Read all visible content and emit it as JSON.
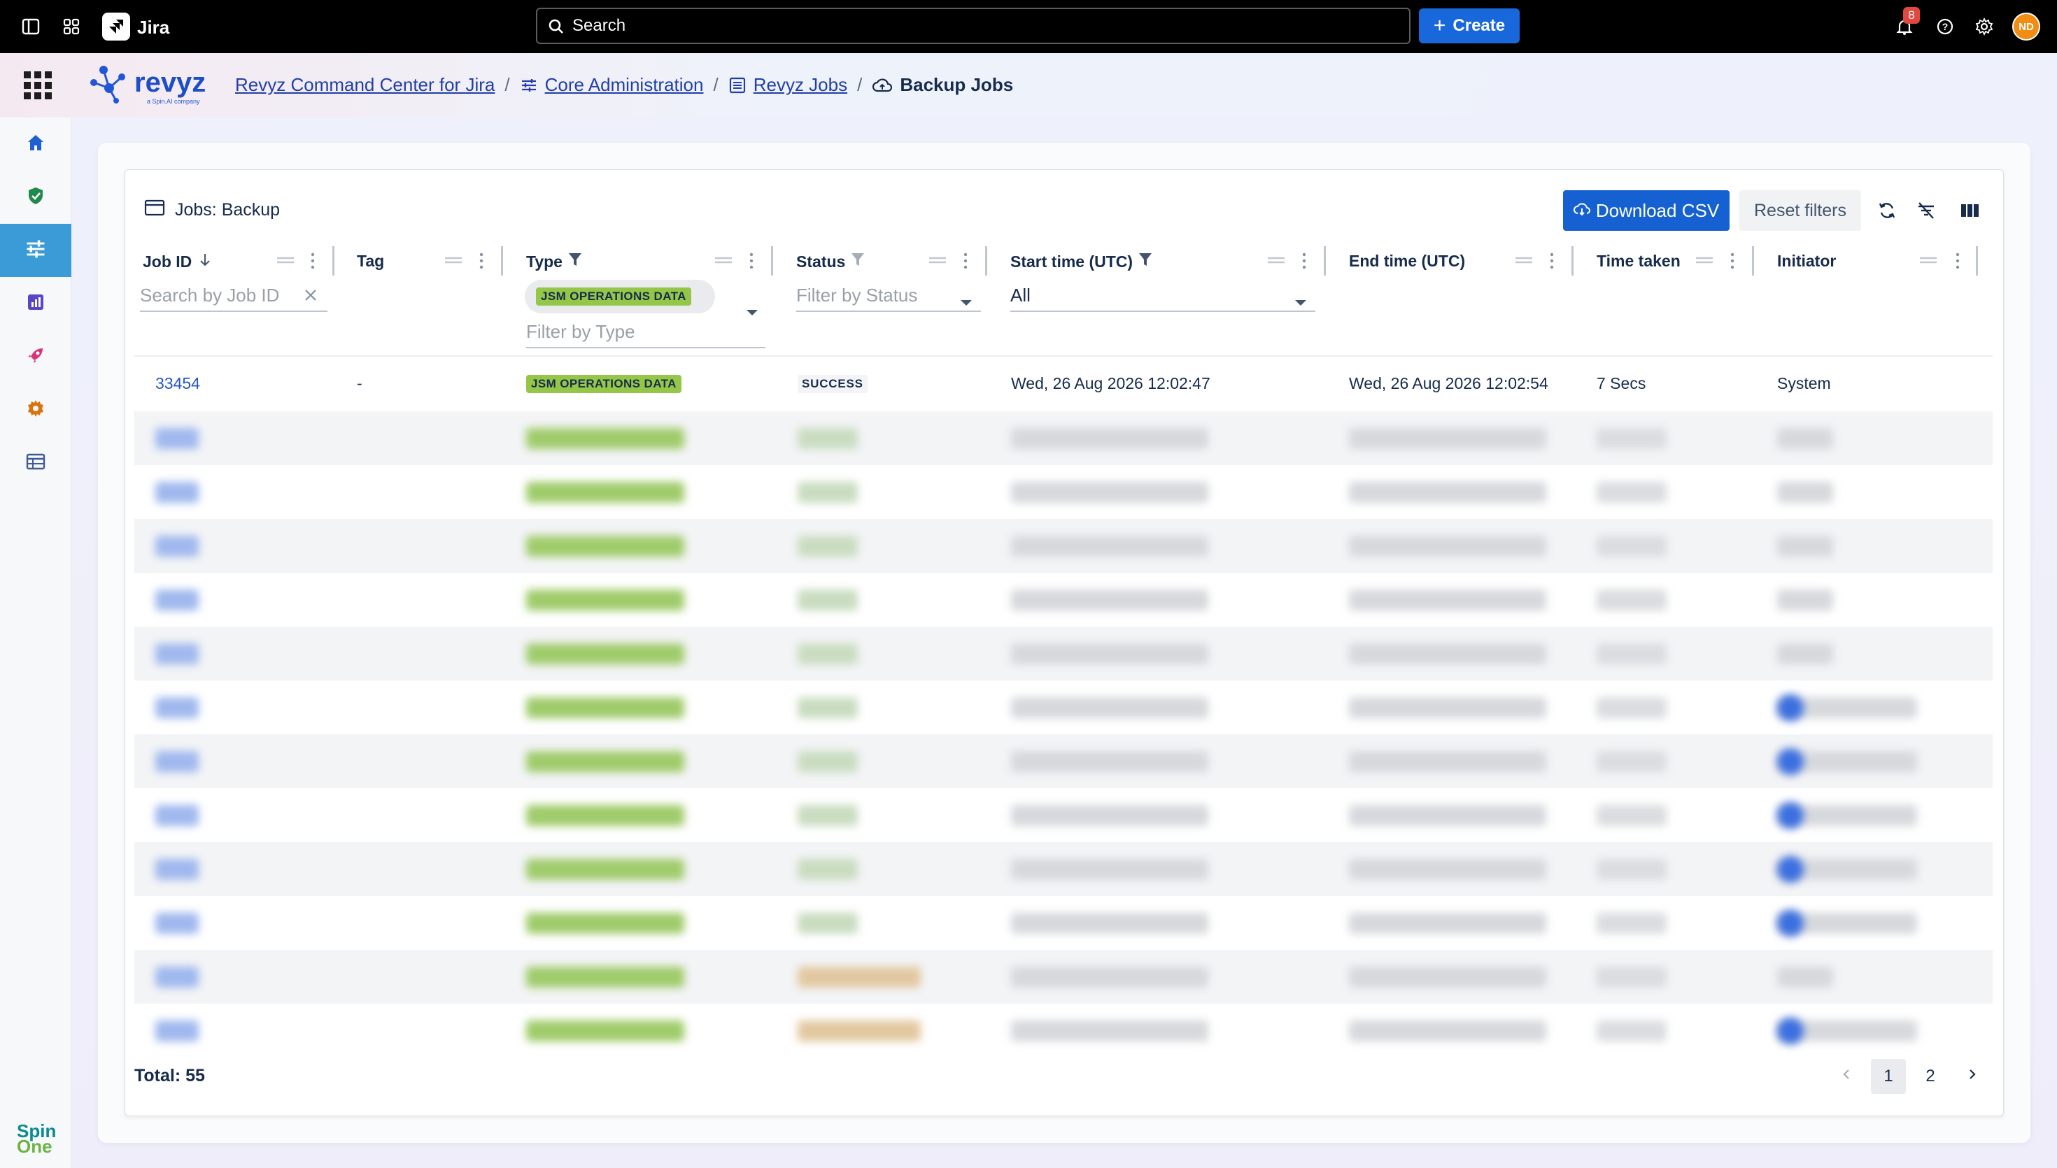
{
  "topbar": {
    "product": "Jira",
    "search_placeholder": "Search",
    "create_label": "Create",
    "notification_count": "8",
    "avatar_initials": "ND"
  },
  "breadcrumb": {
    "item1": "Revyz Command Center for Jira",
    "item2": "Core Administration",
    "item3": "Revyz Jobs",
    "current": "Backup Jobs"
  },
  "logo": {
    "brand": "revyz",
    "sub": "a Spin.AI company"
  },
  "sidebar": {
    "items": [
      "home-icon",
      "shield-check-icon",
      "sliders-icon",
      "chart-icon",
      "rocket-icon",
      "gear-icon",
      "table-icon"
    ],
    "active": "sliders-icon",
    "footer_brand_line1": "Spin",
    "footer_brand_line2": "One"
  },
  "panel": {
    "title": "Jobs: Backup",
    "download_label": "Download CSV",
    "reset_label": "Reset filters"
  },
  "table": {
    "columns": {
      "job_id": "Job ID",
      "tag": "Tag",
      "type": "Type",
      "status": "Status",
      "start": "Start time (UTC)",
      "end": "End time (UTC)",
      "time_taken": "Time taken",
      "initiator": "Initiator"
    },
    "filters": {
      "job_id_placeholder": "Search by Job ID",
      "type_chip": "JSM OPERATIONS DATA",
      "type_placeholder": "Filter by Type",
      "status_placeholder": "Filter by Status",
      "start_value": "All"
    },
    "first_row": {
      "job_id": "33454",
      "tag": "-",
      "type": "JSM OPERATIONS DATA",
      "status": "SUCCESS",
      "start": "Wed, 26 Aug 2026 12:02:47",
      "end": "Wed, 26 Aug 2026 12:02:54",
      "time_taken": "7 Secs",
      "initiator": "System"
    }
  },
  "footer": {
    "total": "Total: 55",
    "pages": [
      "1",
      "2"
    ],
    "current_page": "1"
  },
  "colors": {
    "primary": "#1561d1",
    "create": "#1868db",
    "tag_green": "#94c748",
    "sidebar_active": "#3a9bd6",
    "link": "#2358c9"
  }
}
